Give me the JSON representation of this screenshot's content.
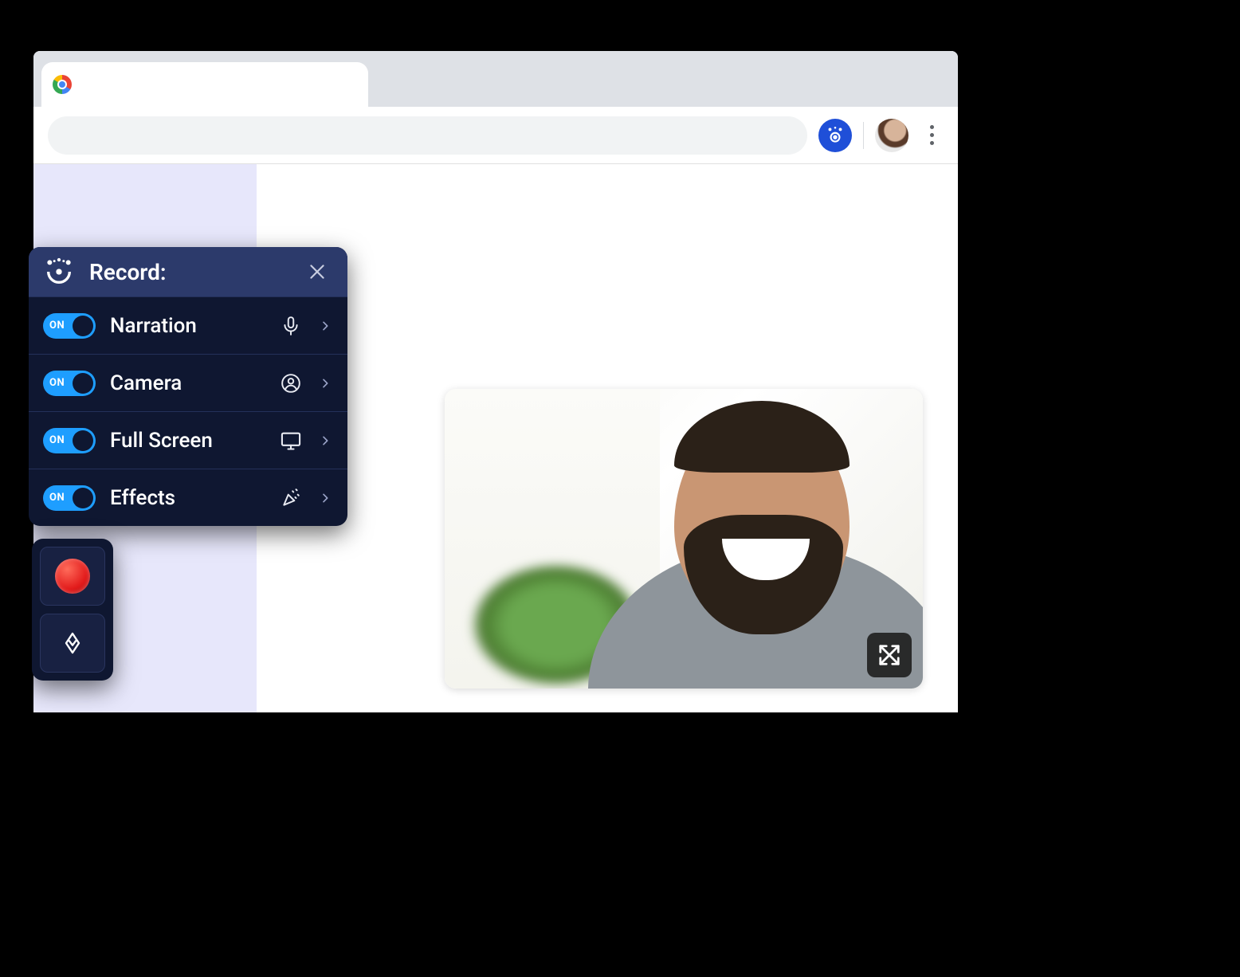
{
  "colors": {
    "panel_bg": "#0f1731",
    "panel_header_bg": "#2c3a6b",
    "toggle_on": "#1e9eff",
    "accent_blue": "#1f4fd8",
    "record_red": "#e21b1b"
  },
  "browser": {
    "tab_title": "",
    "omnibox_value": ""
  },
  "panel": {
    "title": "Record:",
    "rows": [
      {
        "label": "Narration",
        "toggle": "ON",
        "icon": "microphone-icon"
      },
      {
        "label": "Camera",
        "toggle": "ON",
        "icon": "person-circle-icon"
      },
      {
        "label": "Full Screen",
        "toggle": "ON",
        "icon": "monitor-icon"
      },
      {
        "label": "Effects",
        "toggle": "ON",
        "icon": "confetti-icon"
      }
    ]
  },
  "controls": {
    "record": "record",
    "draw": "draw"
  },
  "camera_preview": {
    "expand_label": "expand"
  }
}
